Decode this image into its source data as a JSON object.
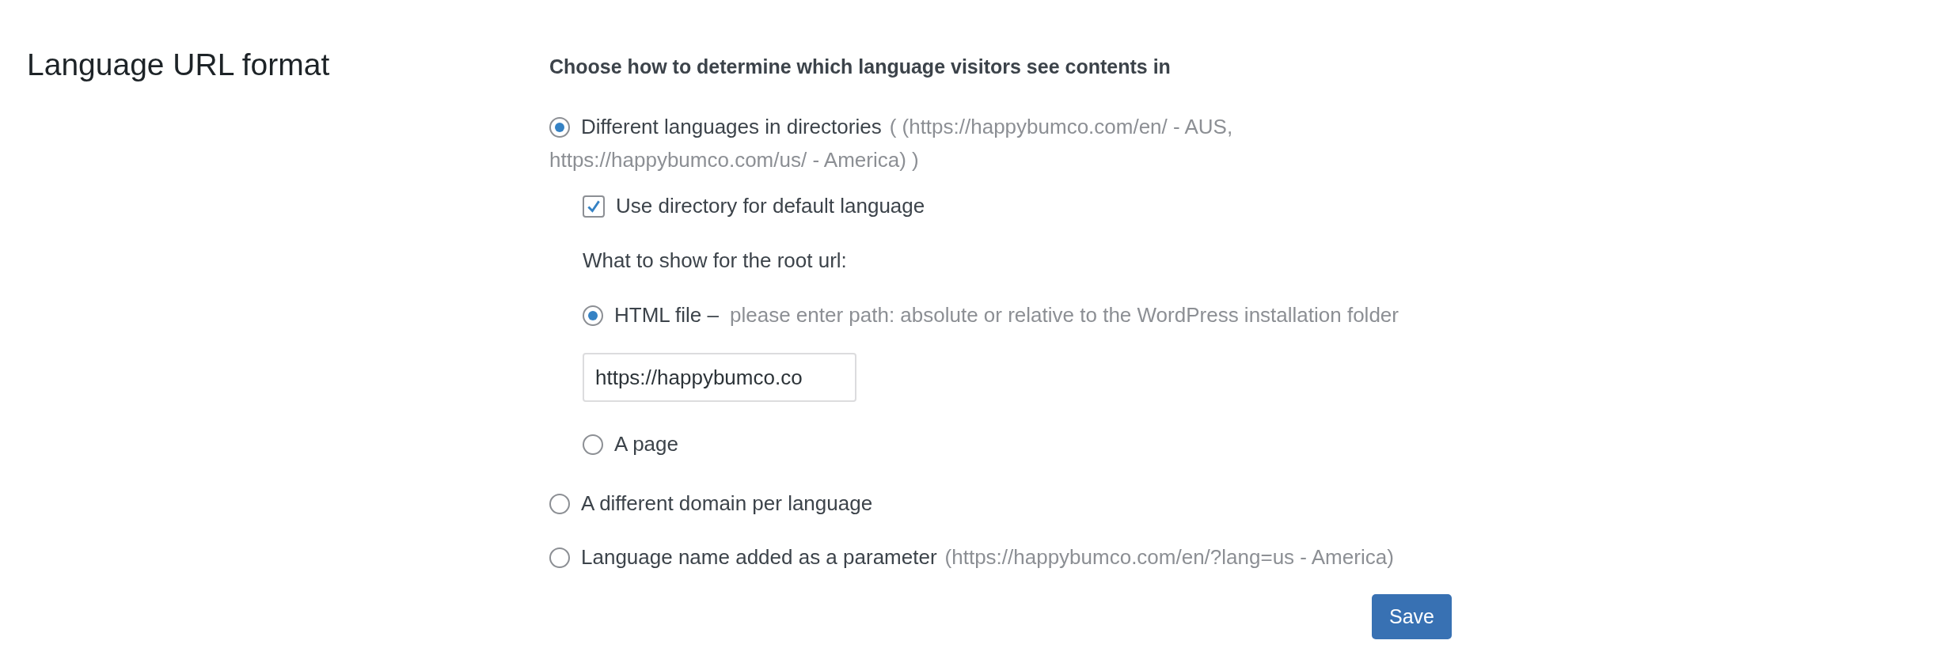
{
  "section": {
    "title": "Language URL format"
  },
  "prompt": "Choose how to determine which language visitors see contents in",
  "options": [
    {
      "label": "Different languages in directories",
      "hint_lines": [
        "( (https://happybumco.com/en/ - AUS,",
        "https://happybumco.com/us/ - America) )"
      ],
      "selected": true,
      "checkbox": {
        "label": "Use directory for default language",
        "checked": true
      },
      "root_url": {
        "label": "What to show for the root url:",
        "options": [
          {
            "label": "HTML file –",
            "hint": "please enter path: absolute or relative to the WordPress installation folder",
            "selected": true,
            "field": {
              "value": "https://happybumco.co"
            }
          },
          {
            "label": "A page",
            "selected": false
          }
        ]
      }
    },
    {
      "label": "A different domain per language",
      "selected": false
    },
    {
      "label": "Language name added as a parameter",
      "hint_lines": [
        "(https://happybumco.com/en/?lang=us - America)"
      ],
      "selected": false
    }
  ],
  "save_button": "Save"
}
